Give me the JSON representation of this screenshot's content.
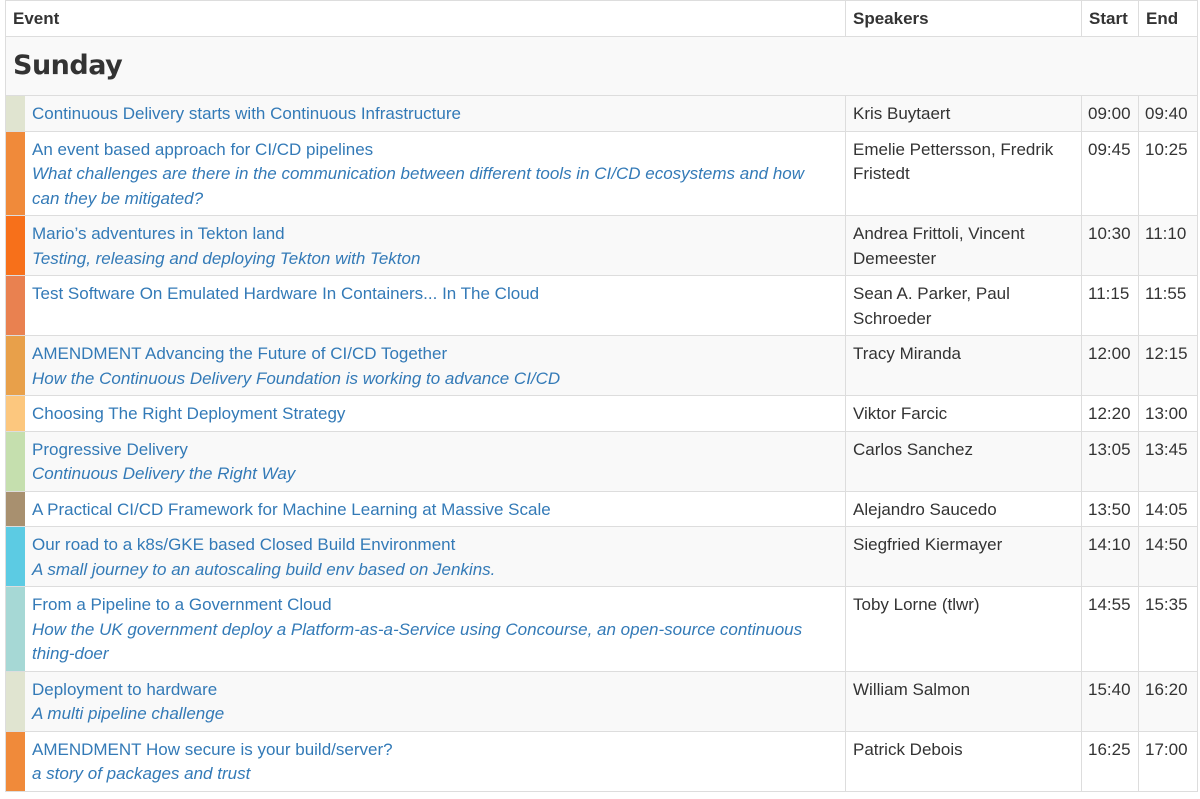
{
  "headers": {
    "event": "Event",
    "speakers": "Speakers",
    "start": "Start",
    "end": "End"
  },
  "day": "Sunday",
  "events": [
    {
      "title": "Continuous Delivery starts with Continuous Infrastructure",
      "subtitle": "",
      "speakers": "Kris Buytaert",
      "start": "09:00",
      "end": "09:40",
      "color": "#e0e4d0"
    },
    {
      "title": "An event based approach for CI/CD pipelines",
      "subtitle": "What challenges are there in the communication between different tools in CI/CD ecosystems and how can they be mitigated?",
      "speakers": "Emelie Pettersson, Fredrik Fristedt",
      "start": "09:45",
      "end": "10:25",
      "color": "#f08a3a"
    },
    {
      "title": "Mario’s adventures in Tekton land",
      "subtitle": "Testing, releasing and deploying Tekton with Tekton",
      "speakers": "Andrea Frittoli, Vincent Demeester",
      "start": "10:30",
      "end": "11:10",
      "color": "#f7701a"
    },
    {
      "title": "Test Software On Emulated Hardware In Containers... In The Cloud",
      "subtitle": "",
      "speakers": "Sean A. Parker, Paul Schroeder",
      "start": "11:15",
      "end": "11:55",
      "color": "#e98150"
    },
    {
      "title": "AMENDMENT Advancing the Future of CI/CD Together",
      "subtitle": "How the Continuous Delivery Foundation is working to advance CI/CD",
      "speakers": "Tracy Miranda",
      "start": "12:00",
      "end": "12:15",
      "color": "#e8a04a"
    },
    {
      "title": "Choosing The Right Deployment Strategy",
      "subtitle": "",
      "speakers": "Viktor Farcic",
      "start": "12:20",
      "end": "13:00",
      "color": "#fcc77e"
    },
    {
      "title": "Progressive Delivery",
      "subtitle": "Continuous Delivery the Right Way",
      "speakers": "Carlos Sanchez",
      "start": "13:05",
      "end": "13:45",
      "color": "#c5dfae"
    },
    {
      "title": "A Practical CI/CD Framework for Machine Learning at Massive Scale",
      "subtitle": "",
      "speakers": "Alejandro Saucedo",
      "start": "13:50",
      "end": "14:05",
      "color": "#a8906f"
    },
    {
      "title": "Our road to a k8s/GKE based Closed Build Environment",
      "subtitle": "A small journey to an autoscaling build env based on Jenkins.",
      "speakers": "Siegfried Kiermayer",
      "start": "14:10",
      "end": "14:50",
      "color": "#5ccbe3"
    },
    {
      "title": "From a Pipeline to a Government Cloud",
      "subtitle": "How the UK government deploy a Platform-as-a-Service using Concourse, an open-source continuous thing-doer",
      "speakers": "Toby Lorne (tlwr)",
      "start": "14:55",
      "end": "15:35",
      "color": "#a6d8d5"
    },
    {
      "title": "Deployment to hardware",
      "subtitle": "A multi pipeline challenge",
      "speakers": "William Salmon",
      "start": "15:40",
      "end": "16:20",
      "color": "#e0e4d0"
    },
    {
      "title": "AMENDMENT How secure is your build/server?",
      "subtitle": "a story of packages and trust",
      "speakers": "Patrick Debois",
      "start": "16:25",
      "end": "17:00",
      "color": "#f08a3a"
    }
  ]
}
